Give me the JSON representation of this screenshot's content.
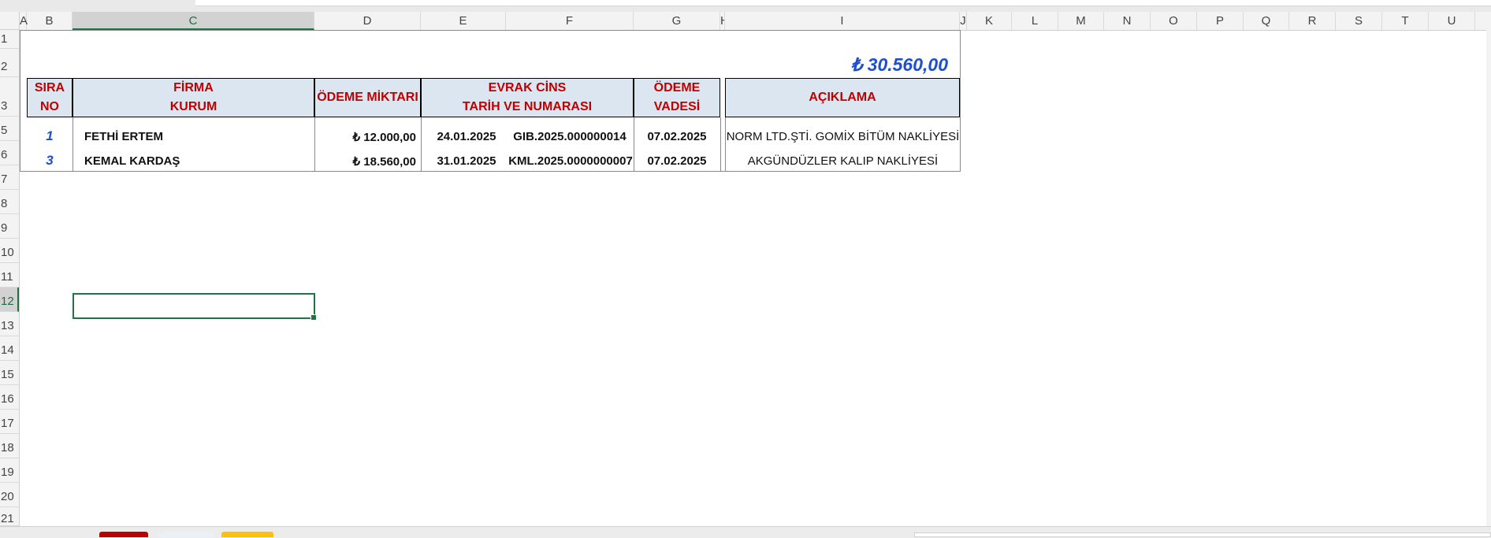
{
  "columns": [
    "A",
    "B",
    "C",
    "D",
    "E",
    "F",
    "G",
    "H",
    "I",
    "J",
    "K",
    "L",
    "M",
    "N",
    "O",
    "P",
    "Q",
    "R",
    "S",
    "T",
    "U"
  ],
  "rows": [
    "1",
    "2",
    "3",
    "5",
    "6",
    "7",
    "8",
    "9",
    "10",
    "11",
    "12",
    "13",
    "14",
    "15",
    "16",
    "17",
    "18",
    "19",
    "20",
    "21"
  ],
  "total": "₺ 30.560,00",
  "headers": {
    "sira": "SIRA\nNO",
    "firma": "FİRMA\nKURUM",
    "odeme_miktari": "ÖDEME MİKTARI",
    "evrak": "EVRAK CİNS\nTARİH VE NUMARASI",
    "vade": "ÖDEME\nVADESİ",
    "aciklama": "AÇIKLAMA"
  },
  "records": [
    {
      "no": "1",
      "firma": "FETHİ ERTEM",
      "miktar": "₺ 12.000,00",
      "tarih": "24.01.2025",
      "evrak_no": "GIB.2025.000000014",
      "vade": "07.02.2025",
      "aciklama": "NORM LTD.ŞTİ.  GOMİX BİTÜM NAKLİYESİ"
    },
    {
      "no": "3",
      "firma": "KEMAL KARDAŞ",
      "miktar": "₺ 18.560,00",
      "tarih": "31.01.2025",
      "evrak_no": "KML.2025.0000000007",
      "vade": "07.02.2025",
      "aciklama": "AKGÜNDÜZLER KALIP NAKLİYESİ"
    }
  ],
  "selected_cell": "C12",
  "colors": {
    "header_fill": "#dce6f1",
    "header_text": "#c00000",
    "number_blue": "#1f4fd1",
    "selection": "#217346"
  }
}
